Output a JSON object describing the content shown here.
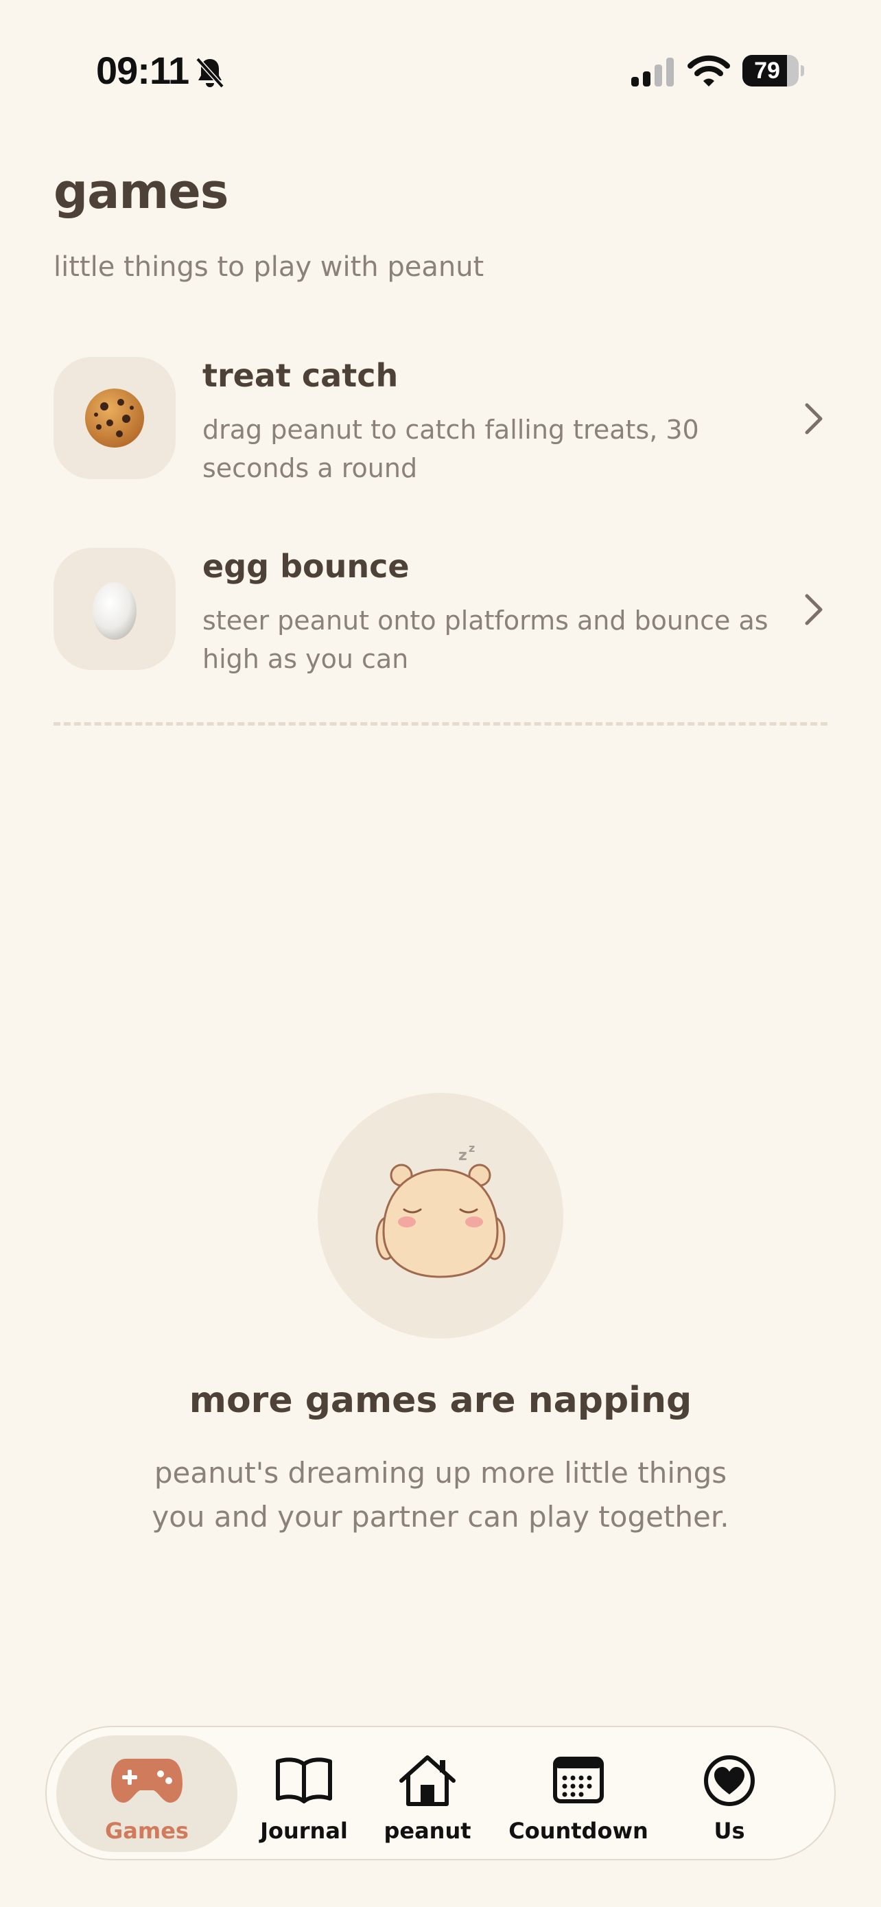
{
  "status_bar": {
    "time": "09:11",
    "battery": "79",
    "battery_fraction": 0.79
  },
  "header": {
    "title": "games",
    "subtitle": "little things to play with peanut"
  },
  "games": [
    {
      "title": "treat catch",
      "description": "drag peanut to catch falling treats, 30 seconds a round",
      "icon": "cookie-icon"
    },
    {
      "title": "egg bounce",
      "description": "steer peanut onto platforms and bounce as high as you can",
      "icon": "egg-icon"
    }
  ],
  "empty_state": {
    "title": "more games are napping",
    "description": "peanut's dreaming up more little things you and your partner can play together."
  },
  "tabbar": {
    "items": [
      {
        "label": "Games",
        "icon": "gamepad-icon",
        "active": true
      },
      {
        "label": "Journal",
        "icon": "book-icon",
        "active": false
      },
      {
        "label": "peanut",
        "icon": "home-icon",
        "active": false
      },
      {
        "label": "Countdown",
        "icon": "calendar-icon",
        "active": false
      },
      {
        "label": "Us",
        "icon": "heart-icon",
        "active": false
      }
    ]
  },
  "colors": {
    "background": "#faf6ee",
    "text": "#4e4238",
    "muted": "#8a8178",
    "accent": "#d07b5c"
  }
}
